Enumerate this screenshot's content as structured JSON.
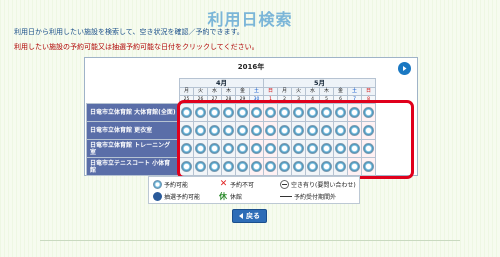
{
  "title": "利用日検索",
  "instructions": {
    "line1": "利用日から利用したい施設を検索して、空き状況を確認／予約できます。",
    "line2": "利用したい施設の予約可能又は抽選予約可能な日付をクリックしてください。"
  },
  "calendar": {
    "year_label": "2016年",
    "next_icon": "next-arrow-icon",
    "months": [
      {
        "label": "4月",
        "span": 6
      },
      {
        "label": "5月",
        "span": 8
      }
    ],
    "days": [
      {
        "dow": "月",
        "date": "25",
        "type": "weekday"
      },
      {
        "dow": "火",
        "date": "26",
        "type": "weekday"
      },
      {
        "dow": "水",
        "date": "27",
        "type": "weekday"
      },
      {
        "dow": "木",
        "date": "28",
        "type": "weekday"
      },
      {
        "dow": "金",
        "date": "29",
        "type": "weekday"
      },
      {
        "dow": "土",
        "date": "30",
        "type": "sat"
      },
      {
        "dow": "日",
        "date": "1",
        "type": "sun"
      },
      {
        "dow": "月",
        "date": "2",
        "type": "weekday"
      },
      {
        "dow": "火",
        "date": "3",
        "type": "weekday"
      },
      {
        "dow": "水",
        "date": "4",
        "type": "weekday"
      },
      {
        "dow": "木",
        "date": "5",
        "type": "weekday"
      },
      {
        "dow": "金",
        "date": "6",
        "type": "weekday"
      },
      {
        "dow": "土",
        "date": "7",
        "type": "sat"
      },
      {
        "dow": "日",
        "date": "8",
        "type": "sun"
      }
    ],
    "facilities": [
      {
        "name": "日竜市立体育館 大体育館(全面)"
      },
      {
        "name": "日竜市立体育館 更衣室"
      },
      {
        "name": "日竜市立体育館 トレーニング室"
      },
      {
        "name": "日竜市立テニスコート 小体育館"
      }
    ],
    "cell_status": "available"
  },
  "legend": [
    {
      "icon": "available-circle-icon",
      "label": "予約可能"
    },
    {
      "icon": "unavailable-x-icon",
      "label": "予約不可"
    },
    {
      "icon": "partial-available-icon",
      "label": "空き有り(要問い合わせ)"
    },
    {
      "icon": "lottery-circle-icon",
      "label": "抽選予約可能"
    },
    {
      "icon": "closed-kyu-icon",
      "label": "休館"
    },
    {
      "icon": "out-of-period-dash-icon",
      "label": "予約受付期間外"
    }
  ],
  "back_button": {
    "label": "戻る"
  }
}
